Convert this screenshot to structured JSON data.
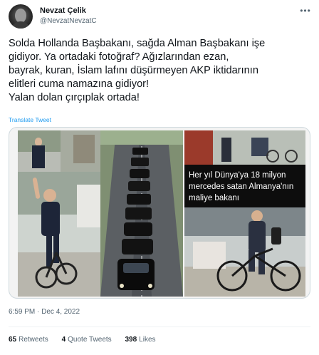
{
  "user": {
    "name": "Nevzat Çelik",
    "handle": "@NevzatNevzatC"
  },
  "tweet": {
    "lines": [
      "Solda Hollanda Başbakanı, sağda Alman Başbakanı işe",
      "gidiyor. Ya ortadaki fotoğraf? Ağızlarından ezan,",
      "bayrak, kuran, İslam lafını düşürmeyen AKP iktidarının",
      "elitleri cuma namazına gidiyor!",
      "Yalan dolan çırçıplak ortada!"
    ],
    "translate_label": "Translate Tweet",
    "image_caption_lines": [
      "Her yıl Dünya'ya 18 milyon",
      "mercedes satan Almanya'nın",
      "maliye bakanı"
    ],
    "timestamp": "6:59 PM · Dec 4, 2022"
  },
  "stats": {
    "retweets": {
      "count": "65",
      "label": "Retweets"
    },
    "quotes": {
      "count": "4",
      "label": "Quote Tweets"
    },
    "likes": {
      "count": "398",
      "label": "Likes"
    }
  },
  "icons": {
    "more": "more-options-icon"
  }
}
